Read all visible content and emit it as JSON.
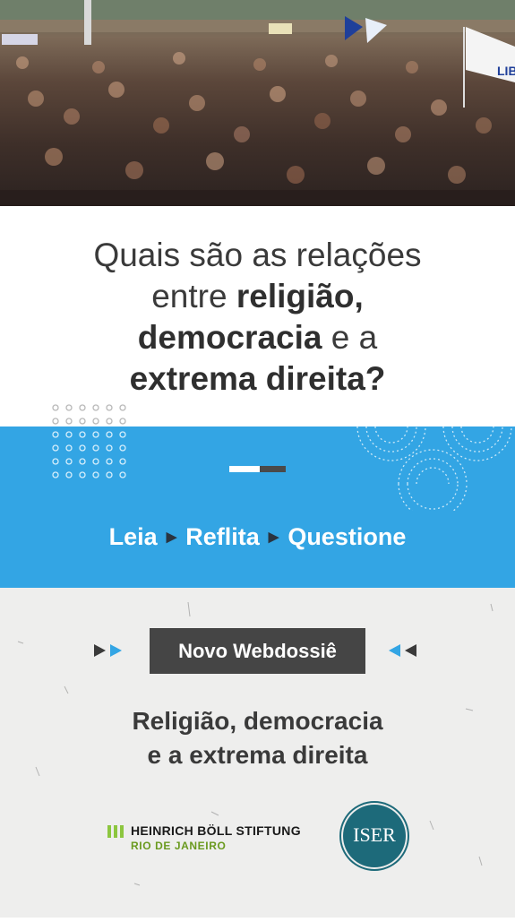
{
  "question": {
    "line1": "Quais são as relações",
    "line2_plain": "entre ",
    "line2_bold": "religião,",
    "line3_bold": "democracia",
    "line3_plain": " e a",
    "line4_bold": "extrema direita?"
  },
  "tagline": {
    "word1": "Leia",
    "word2": "Reflita",
    "word3": "Questione",
    "separator": "▶"
  },
  "badge": {
    "label": "Novo Webdossiê"
  },
  "subtitle": {
    "line1": "Religião, democracia",
    "line2": "e a extrema direita"
  },
  "logos": {
    "hbs_name": "HEINRICH BÖLL STIFTUNG",
    "hbs_city": "RIO DE JANEIRO",
    "iser": "ISER"
  },
  "photo": {
    "flag_text": "LIBE"
  },
  "colors": {
    "band": "#33a5e4",
    "badge": "#454545",
    "hbs_green": "#6a9a1f",
    "iser_teal": "#1d6a7a"
  }
}
